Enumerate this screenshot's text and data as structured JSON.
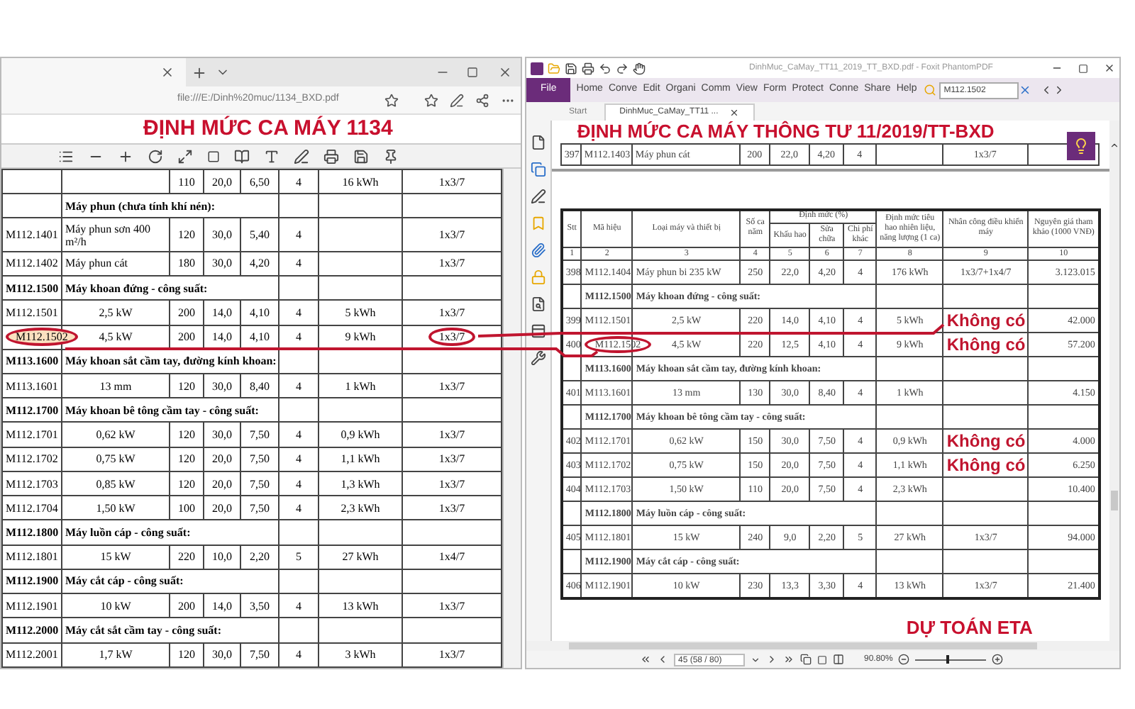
{
  "left_window": {
    "url": "file:///E:/Dinh%20muc/1134_BXD.pdf",
    "title_overlay": "ĐỊNH MỨC CA MÁY 1134",
    "table": {
      "rows": [
        {
          "kind": "item",
          "shifts": "110",
          "depreciation": "20,0",
          "repair": "6,50",
          "other": "4",
          "energy": "16 kWh",
          "crew": "1x3/7"
        },
        {
          "kind": "section",
          "name": "Máy phun (chưa tính khí nén):"
        },
        {
          "kind": "item",
          "code": "M112.1401",
          "name": "Máy phun sơn 400 m²/h",
          "shifts": "120",
          "depreciation": "30,0",
          "repair": "5,40",
          "other": "4",
          "crew": "1x3/7"
        },
        {
          "kind": "item",
          "code": "M112.1402",
          "name": "Máy phun cát",
          "shifts": "180",
          "depreciation": "30,0",
          "repair": "4,20",
          "other": "4",
          "crew": "1x3/7"
        },
        {
          "kind": "section",
          "code": "M112.1500",
          "name": "Máy khoan đứng - công suất:"
        },
        {
          "kind": "item",
          "code": "M112.1501",
          "name": "2,5 kW",
          "shifts": "200",
          "depreciation": "14,0",
          "repair": "4,10",
          "other": "4",
          "energy": "5 kWh",
          "crew": "1x3/7"
        },
        {
          "kind": "item",
          "code": "M112.1502",
          "name": "4,5 kW",
          "shifts": "200",
          "depreciation": "14,0",
          "repair": "4,10",
          "other": "4",
          "energy": "9 kWh",
          "crew": "1x3/7",
          "code_circled": true,
          "code_highlighted": true,
          "crew_circled": true
        },
        {
          "kind": "section",
          "code": "M113.1600",
          "name": "Máy khoan sắt cầm tay, đường kính khoan:"
        },
        {
          "kind": "item",
          "code": "M113.1601",
          "name": "13 mm",
          "shifts": "120",
          "depreciation": "30,0",
          "repair": "8,40",
          "other": "4",
          "energy": "1 kWh",
          "crew": "1x3/7"
        },
        {
          "kind": "section",
          "code": "M112.1700",
          "name": "Máy khoan bê tông cầm tay - công suất:"
        },
        {
          "kind": "item",
          "code": "M112.1701",
          "name": "0,62 kW",
          "shifts": "120",
          "depreciation": "30,0",
          "repair": "7,50",
          "other": "4",
          "energy": "0,9 kWh",
          "crew": "1x3/7"
        },
        {
          "kind": "item",
          "code": "M112.1702",
          "name": "0,75 kW",
          "shifts": "120",
          "depreciation": "20,0",
          "repair": "7,50",
          "other": "4",
          "energy": "1,1 kWh",
          "crew": "1x3/7"
        },
        {
          "kind": "item",
          "code": "M112.1703",
          "name": "0,85 kW",
          "shifts": "120",
          "depreciation": "20,0",
          "repair": "7,50",
          "other": "4",
          "energy": "1,3 kWh",
          "crew": "1x3/7"
        },
        {
          "kind": "item",
          "code": "M112.1704",
          "name": "1,50 kW",
          "shifts": "100",
          "depreciation": "20,0",
          "repair": "7,50",
          "other": "4",
          "energy": "2,3 kWh",
          "crew": "1x3/7"
        },
        {
          "kind": "section",
          "code": "M112.1800",
          "name": "Máy luồn cáp - công suất:"
        },
        {
          "kind": "item",
          "code": "M112.1801",
          "name": "15 kW",
          "shifts": "220",
          "depreciation": "10,0",
          "repair": "2,20",
          "other": "5",
          "energy": "27 kWh",
          "crew": "1x4/7"
        },
        {
          "kind": "section",
          "code": "M112.1900",
          "name": "Máy cắt cáp - công suất:"
        },
        {
          "kind": "item",
          "code": "M112.1901",
          "name": "10 kW",
          "shifts": "200",
          "depreciation": "14,0",
          "repair": "3,50",
          "other": "4",
          "energy": "13 kWh",
          "crew": "1x3/7"
        },
        {
          "kind": "section",
          "code": "M112.2000",
          "name": "Máy cắt sắt cầm tay - công suất:"
        },
        {
          "kind": "item",
          "code": "M112.2001",
          "name": "1,7 kW",
          "shifts": "120",
          "depreciation": "30,0",
          "repair": "7,50",
          "other": "4",
          "energy": "3 kWh",
          "crew": "1x3/7"
        }
      ]
    }
  },
  "right_window": {
    "title": "DinhMuc_CaMay_TT11_2019_TT_BXD.pdf - Foxit PhantomPDF",
    "file_tab": "File",
    "menu": [
      "Home",
      "Conve",
      "Edit",
      "Organi",
      "Comm",
      "View",
      "Form",
      "Protect",
      "Conne",
      "Share",
      "Help"
    ],
    "search": {
      "value": "M112.1502"
    },
    "doc_tabs": [
      {
        "label": "Start",
        "selected": false
      },
      {
        "label": "DinhMuc_CaMay_TT11 ...",
        "selected": true
      }
    ],
    "title_overlay": "ĐỊNH MỨC CA MÁY THÔNG TƯ 11/2019/TT-BXD",
    "top_row": {
      "kind": "item",
      "stt": "397",
      "code": "M112.1403",
      "name": "Máy phun cát",
      "shifts": "200",
      "depreciation": "22,0",
      "repair": "4,20",
      "other": "4",
      "crew": "1x3/7"
    },
    "table": {
      "header": {
        "stt": "Stt",
        "code": "Mã hiệu",
        "name": "Loại máy và thiết bị",
        "shifts": "Số ca năm",
        "group": "Định mức (%)",
        "depreciation": "Khấu hao",
        "repair": "Sửa chữa",
        "other": "Chi phí khác",
        "energy": "Định mức tiêu hao nhiên liệu, năng lượng (1 ca)",
        "crew": "Nhân công điều khiển máy",
        "price": "Nguyên giá tham khảo (1000 VNĐ)"
      },
      "column_numbers": [
        "1",
        "2",
        "3",
        "4",
        "5",
        "6",
        "7",
        "8",
        "9",
        "10"
      ],
      "rows": [
        {
          "kind": "item",
          "stt": "398",
          "code": "M112.1404",
          "name": "Máy phun bi 235 kW",
          "shifts": "250",
          "depreciation": "22,0",
          "repair": "4,20",
          "other": "4",
          "energy": "176 kWh",
          "crew": "1x3/7+1x4/7",
          "price": "3.123.015"
        },
        {
          "kind": "section",
          "code": "M112.1500",
          "name": "Máy khoan đứng - công suất:"
        },
        {
          "kind": "item",
          "stt": "399",
          "code": "M112.1501",
          "name": "2,5 kW",
          "shifts": "220",
          "depreciation": "14,0",
          "repair": "4,10",
          "other": "4",
          "energy": "5 kWh",
          "note": "Không có",
          "price": "42.000"
        },
        {
          "kind": "item",
          "stt": "400",
          "code": "M112.1502",
          "name": "4,5 kW",
          "shifts": "220",
          "depreciation": "12,5",
          "repair": "4,10",
          "other": "4",
          "energy": "9 kWh",
          "note": "Không có",
          "price": "57.200",
          "code_circled": true
        },
        {
          "kind": "section",
          "code": "M113.1600",
          "name": "Máy khoan sắt cầm tay, đường kính khoan:"
        },
        {
          "kind": "item",
          "stt": "401",
          "code": "M113.1601",
          "name": "13 mm",
          "shifts": "130",
          "depreciation": "30,0",
          "repair": "8,40",
          "other": "4",
          "energy": "1 kWh",
          "price": "4.150"
        },
        {
          "kind": "section",
          "code": "M112.1700",
          "name": "Máy khoan bê tông cầm tay - công suất:"
        },
        {
          "kind": "item",
          "stt": "402",
          "code": "M112.1701",
          "name": "0,62 kW",
          "shifts": "150",
          "depreciation": "30,0",
          "repair": "7,50",
          "other": "4",
          "energy": "0,9 kWh",
          "note": "Không có",
          "price": "4.000"
        },
        {
          "kind": "item",
          "stt": "403",
          "code": "M112.1702",
          "name": "0,75 kW",
          "shifts": "150",
          "depreciation": "20,0",
          "repair": "7,50",
          "other": "4",
          "energy": "1,1 kWh",
          "note": "Không có",
          "price": "6.250"
        },
        {
          "kind": "item",
          "stt": "404",
          "code": "M112.1703",
          "name": "1,50 kW",
          "shifts": "110",
          "depreciation": "20,0",
          "repair": "7,50",
          "other": "4",
          "energy": "2,3 kWh",
          "price": "10.400"
        },
        {
          "kind": "section",
          "code": "M112.1800",
          "name": "Máy luồn cáp - công suất:"
        },
        {
          "kind": "item",
          "stt": "405",
          "code": "M112.1801",
          "name": "15 kW",
          "shifts": "240",
          "depreciation": "9,0",
          "repair": "2,20",
          "other": "5",
          "energy": "27 kWh",
          "crew": "1x3/7",
          "price": "94.000"
        },
        {
          "kind": "section",
          "code": "M112.1900",
          "name": "Máy cắt cáp - công suất:"
        },
        {
          "kind": "item",
          "stt": "406",
          "code": "M112.1901",
          "name": "10 kW",
          "shifts": "230",
          "depreciation": "13,3",
          "repair": "3,30",
          "other": "4",
          "energy": "13 kWh",
          "crew": "1x3/7",
          "price": "21.400"
        }
      ]
    },
    "footer_note": "DỰ TOÁN ETA",
    "status": {
      "page": "45 (58 / 80)",
      "zoom": "90.80%",
      "zoom_slider": {
        "level": 0.45
      }
    }
  }
}
